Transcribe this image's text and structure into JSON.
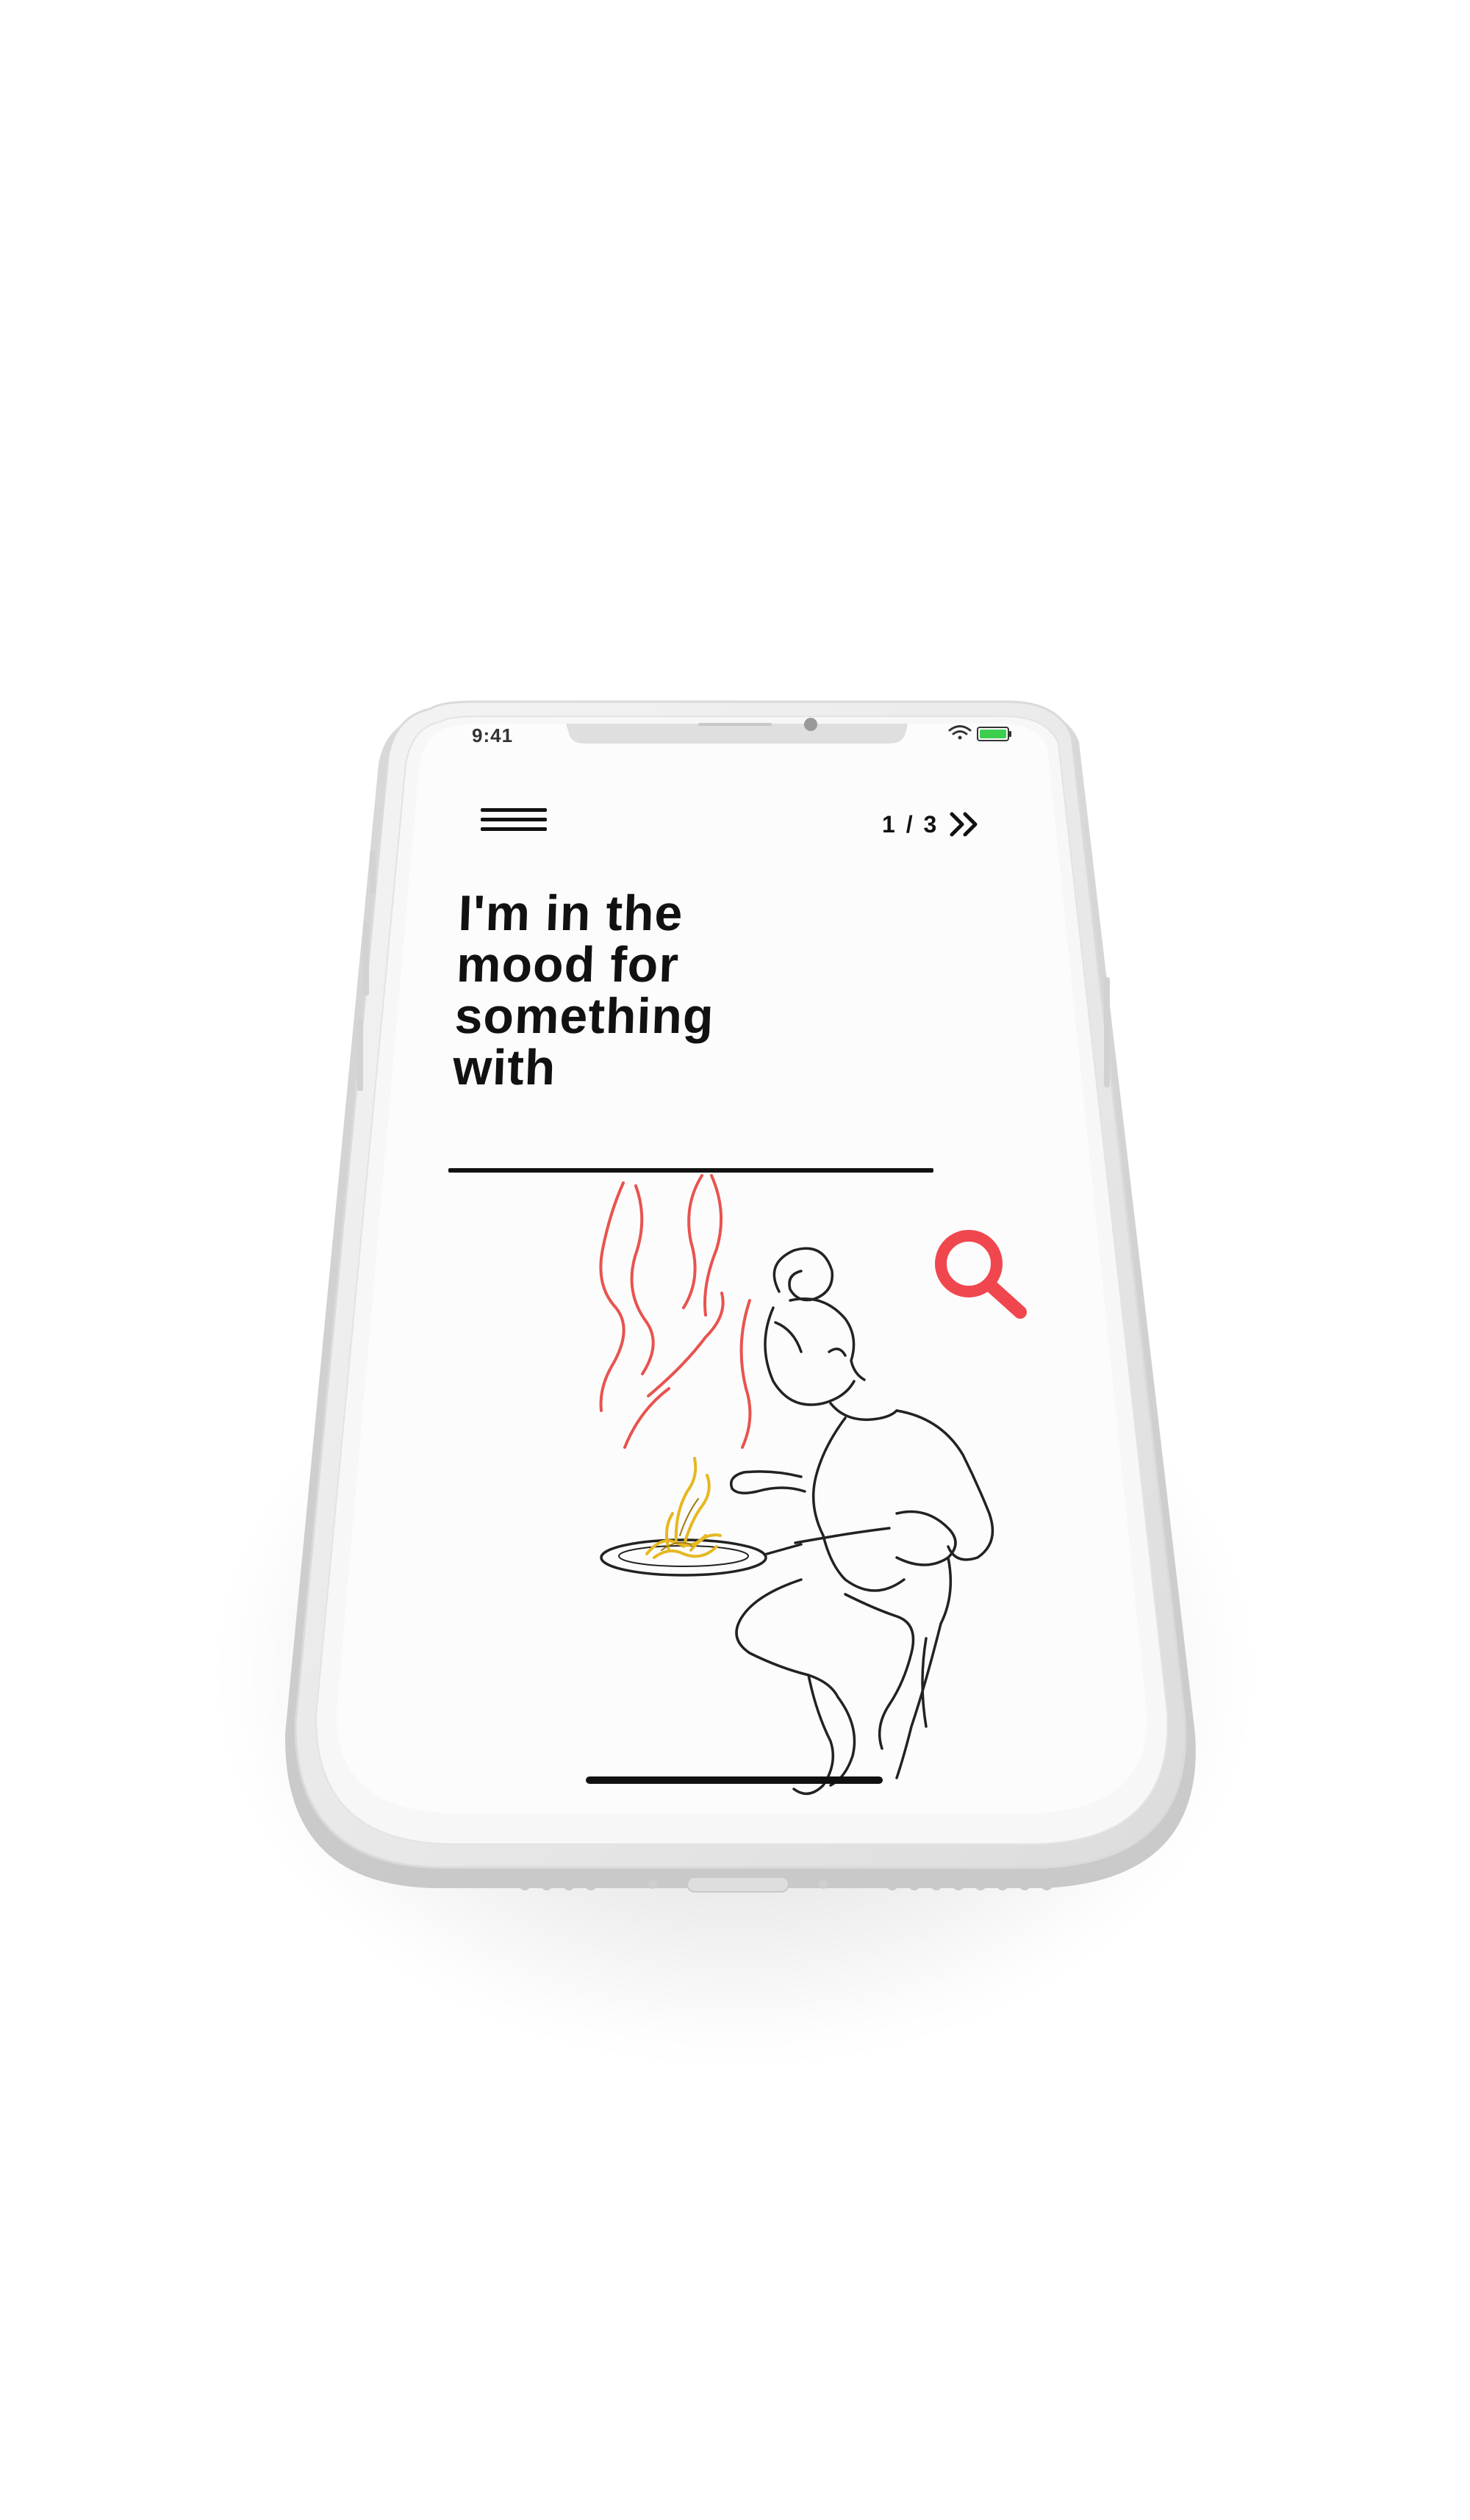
{
  "status_bar": {
    "time": "9:41"
  },
  "toolbar": {
    "menu_icon": "hamburger-menu-icon",
    "pager_label": "1 / 3",
    "next_icon": "double-chevron-right-icon"
  },
  "main": {
    "headline": "I'm in the\nmood for\nsomething\nwith",
    "search_value": "",
    "search_icon": "search-icon"
  },
  "colors": {
    "accent": "#f0474f",
    "text": "#111111",
    "device_frame": "#ebebeb",
    "screen": "#fdfcfc",
    "food": "#e6b821"
  }
}
